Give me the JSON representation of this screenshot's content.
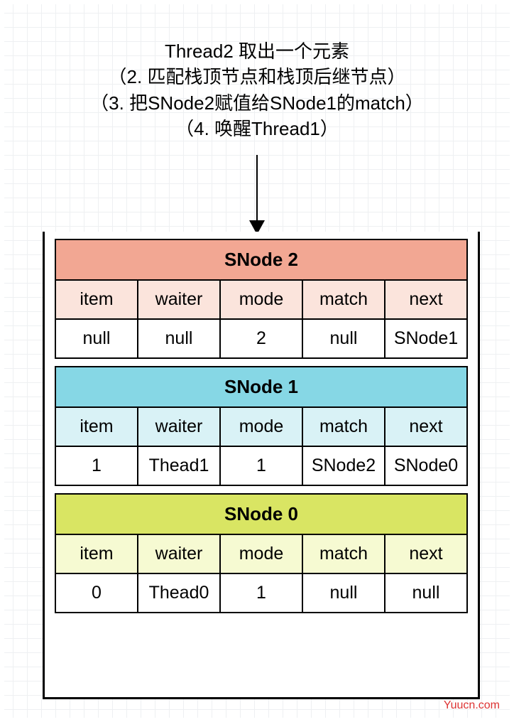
{
  "caption": {
    "line1": "Thread2 取出一个元素",
    "line2": "（2. 匹配栈顶节点和栈顶后继节点）",
    "line3": "（3. 把SNode2赋值给SNode1的match）",
    "line4": "（4. 唤醒Thread1）"
  },
  "columns": {
    "c0": "item",
    "c1": "waiter",
    "c2": "mode",
    "c3": "match",
    "c4": "next"
  },
  "nodes": {
    "n2": {
      "title": "SNode 2",
      "item": "null",
      "waiter": "null",
      "mode": "2",
      "match": "null",
      "next": "SNode1"
    },
    "n1": {
      "title": "SNode 1",
      "item": "1",
      "waiter": "Thead1",
      "mode": "1",
      "match": "SNode2",
      "next": "SNode0"
    },
    "n0": {
      "title": "SNode 0",
      "item": "0",
      "waiter": "Thead0",
      "mode": "1",
      "match": "null",
      "next": "null"
    }
  },
  "watermark": "Yuucn.com"
}
